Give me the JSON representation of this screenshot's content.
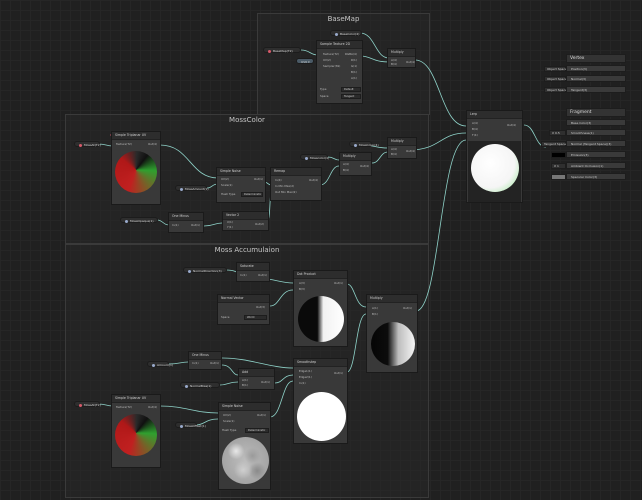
{
  "groups": {
    "basemap": "BaseMap",
    "mosscolor": "MossColor",
    "moss_accumulation": "Moss Accumulaion"
  },
  "properties": {
    "basecolor": "BaseColor(4)",
    "basemap": "BaseMap(T2)",
    "uv0": "UV0 ▾",
    "moss_tex": "MossAt(T2)",
    "moss_color": "Mosscolor(4)",
    "moss_amount": "MossAmount(1)",
    "moss_colorshaded": "MossColor(4)",
    "moss_scale": "MossOpaque(1)",
    "normal_dir": "NormalDirection(3)",
    "world_normal": "NormalBias(1)",
    "mossmap_normal": "NormalsOffset(1)",
    "amount2": "Amount(1)",
    "mossmap2": "MossAt(T2)",
    "moss_offset": "MossOffset(1)"
  },
  "nodes": {
    "sample_texture": {
      "title": "Sample Texture 2D",
      "inputs": [
        "Texture(T2)",
        "UV(2)",
        "Sampler(SS)"
      ],
      "outputs": [
        "RGBA(4)",
        "R(1)",
        "G(1)",
        "B(1)",
        "A(1)"
      ],
      "type_label": "Type",
      "type_value": "Default",
      "space_label": "Space",
      "space_value": "Tangent"
    },
    "multiply_base": {
      "title": "Multiply",
      "inputs": [
        "A(4)",
        "B(4)"
      ],
      "outputs": [
        "Out(4)"
      ]
    },
    "lerp": {
      "title": "Lerp",
      "inputs": [
        "A(4)",
        "B(4)",
        "T(4)"
      ],
      "outputs": [
        "Out(4)"
      ]
    },
    "triplanar1": {
      "title": "Simple Triplanar UV",
      "inputs": [
        "Texture(T2)"
      ],
      "outputs": [
        "Out(4)"
      ]
    },
    "simple_noise1": {
      "title": "Simple Noise",
      "inputs": [
        "UV(2)",
        "Scale(1)"
      ],
      "outputs": [
        "Out(1)"
      ],
      "hash_label": "Hash Type",
      "hash_value": "Deterministic"
    },
    "normal_vec": {
      "title": "Remap",
      "inputs": [
        "In(4)",
        "In Min Max(2)",
        "Out Min Max(2)"
      ],
      "outputs": [
        "Out(4)"
      ]
    },
    "multiply_moss": {
      "title": "Multiply",
      "inputs": [
        "A(4)",
        "B(4)"
      ],
      "outputs": [
        "Out(4)"
      ]
    },
    "multiply_moss2": {
      "title": "Multiply",
      "inputs": [
        "A(4)",
        "B(4)"
      ],
      "outputs": [
        "Out(4)"
      ]
    },
    "one_minus1": {
      "title": "One Minus",
      "inputs": [
        "In(1)"
      ],
      "outputs": [
        "Out(1)"
      ]
    },
    "vector2": {
      "title": "Vector 2",
      "inputs": [
        "X(1)",
        "Y(1)"
      ],
      "outputs": [
        "Out(2)"
      ]
    },
    "saturate": {
      "title": "Saturate",
      "inputs": [
        "In(1)"
      ],
      "outputs": [
        "Out(1)"
      ]
    },
    "normal_vector": {
      "title": "Normal Vector",
      "outputs": [
        "Out(3)"
      ],
      "space_label": "Space",
      "space_value": "World"
    },
    "dot_product": {
      "title": "Dot Product",
      "inputs": [
        "A(3)",
        "B(3)"
      ],
      "outputs": [
        "Out(1)"
      ]
    },
    "multiply_acc": {
      "title": "Multiply",
      "inputs": [
        "A(1)",
        "B(1)"
      ],
      "outputs": [
        "Out(1)"
      ]
    },
    "one_minus2": {
      "title": "One Minus",
      "inputs": [
        "In(1)"
      ],
      "outputs": [
        "Out(1)"
      ]
    },
    "add": {
      "title": "Add",
      "inputs": [
        "A(1)",
        "B(1)"
      ],
      "outputs": [
        "Out(1)"
      ]
    },
    "smoothstep": {
      "title": "Smoothstep",
      "inputs": [
        "Edge1(1)",
        "Edge2(1)",
        "In(1)"
      ],
      "outputs": [
        "Out(1)"
      ]
    },
    "triplanar2": {
      "title": "Simple Triplanar UV",
      "inputs": [
        "Texture(T2)"
      ],
      "outputs": [
        "Out(4)"
      ]
    },
    "simple_noise2": {
      "title": "Simple Noise",
      "inputs": [
        "UV(2)",
        "Scale(1)"
      ],
      "outputs": [
        "Out(1)"
      ],
      "hash_label": "Hash Type",
      "hash_value": "Deterministic"
    }
  },
  "vertex": {
    "title": "Vertex",
    "slots": [
      {
        "tag": "Object Space",
        "label": "Position(3)"
      },
      {
        "tag": "Object Space",
        "label": "Normal(3)"
      },
      {
        "tag": "Object Space",
        "label": "Tangent(3)"
      }
    ]
  },
  "fragment": {
    "title": "Fragment",
    "slots": [
      {
        "tag": "",
        "label": "Base Color(3)"
      },
      {
        "tag": "X 0.5",
        "label": "Smoothness(1)"
      },
      {
        "tag": "Tangent Space",
        "label": "Normal (Tangent Space)(3)"
      },
      {
        "tag": "",
        "label": "Emission(3)"
      },
      {
        "tag": "X 1",
        "label": "Ambient Occlusion(1)"
      },
      {
        "tag": "",
        "label": "Specular Color(3)"
      }
    ]
  },
  "colors": {
    "wire": "#8fd3c9",
    "background": "#202020",
    "node": "#393939"
  }
}
